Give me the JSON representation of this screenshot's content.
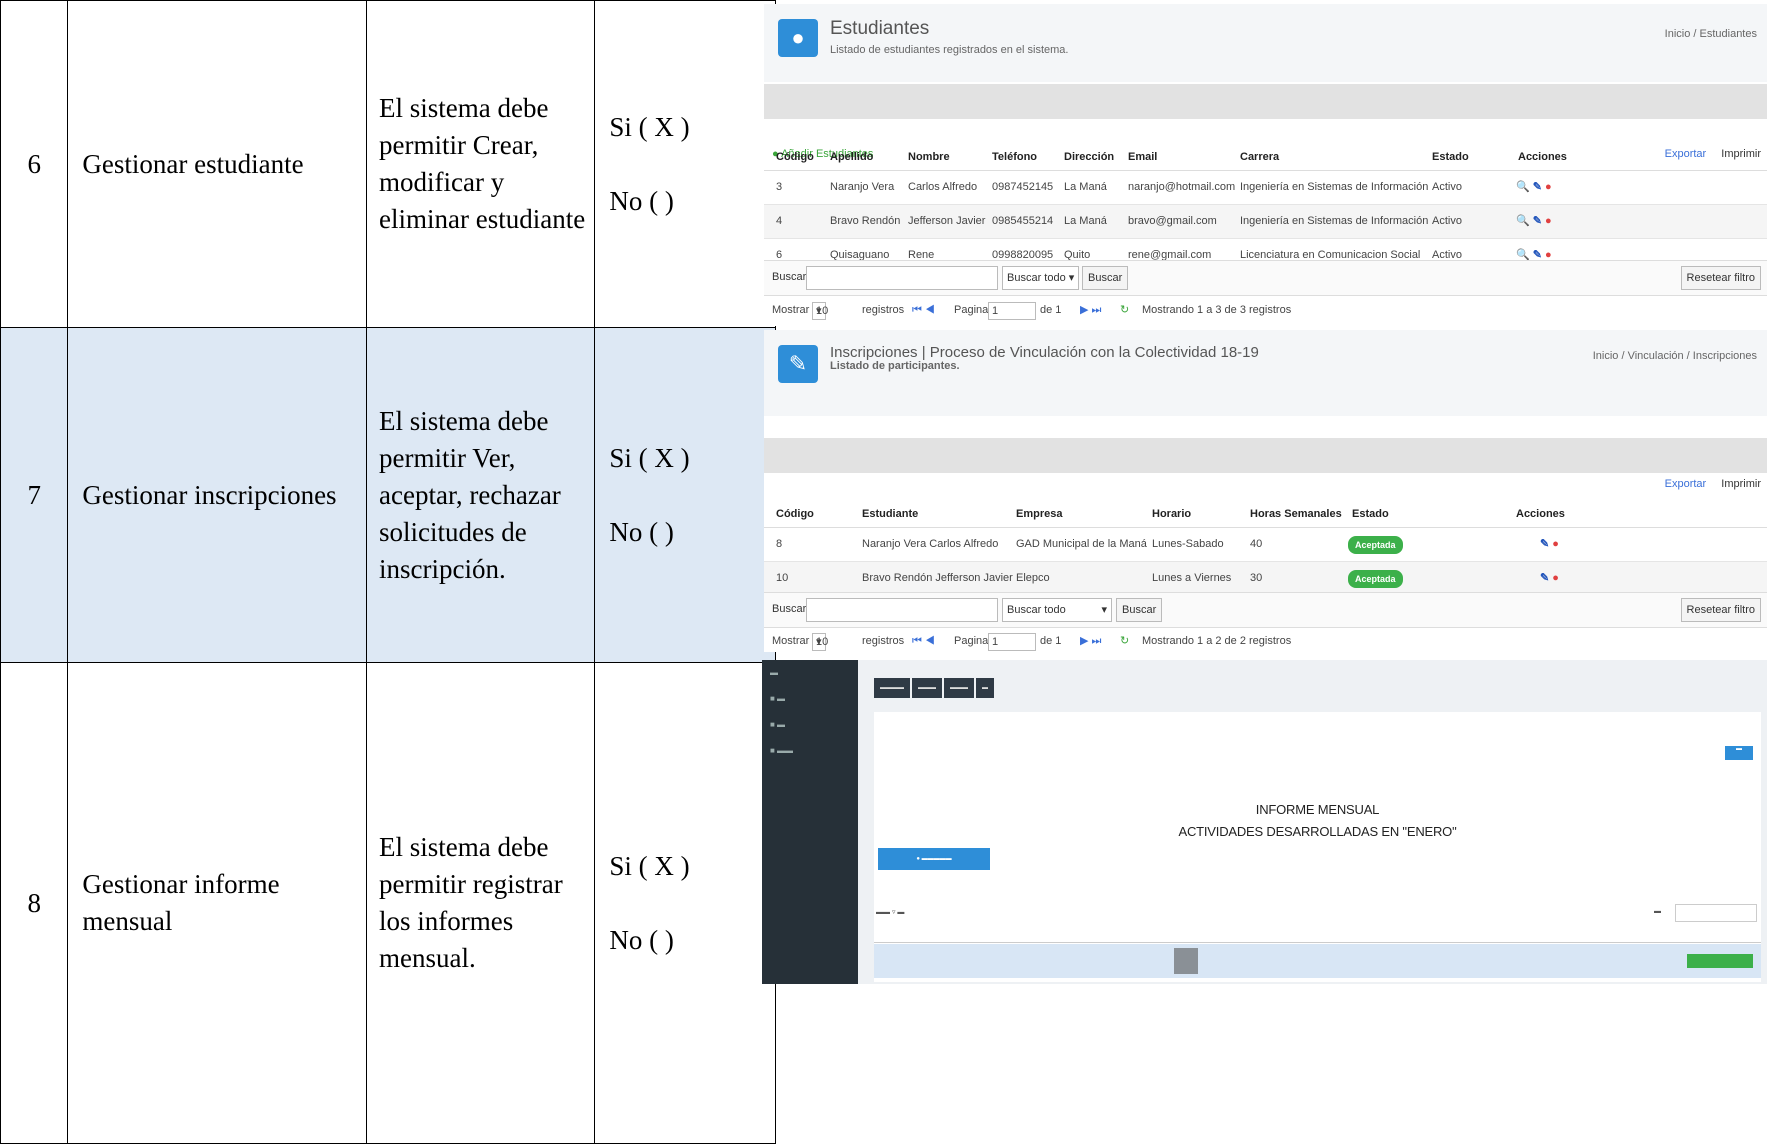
{
  "rows": [
    {
      "num": "6",
      "name": "Gestionar estudiante",
      "desc": "El sistema debe permitir Crear, modificar y eliminar estudiante",
      "si": "Si   ( X )",
      "no": "No (   )"
    },
    {
      "num": "7",
      "name": "Gestionar inscripciones",
      "desc": "El sistema debe permitir Ver, aceptar, rechazar solicitudes de inscripción.",
      "si": "Si   ( X )",
      "no": "No (   )"
    },
    {
      "num": "8",
      "name": "Gestionar informe mensual",
      "desc": "El sistema debe permitir registrar los informes mensual.",
      "si": "Si   ( X )",
      "no": "No (   )"
    }
  ],
  "shot1": {
    "title": "Estudiantes",
    "subtitle": "Listado de estudiantes registrados en el sistema.",
    "breadcrumb": "Inicio  /  Estudiantes",
    "add": "Añadir Estudiantes",
    "export": "Exportar",
    "print": "Imprimir",
    "headers": [
      "Código",
      "Apellido",
      "Nombre",
      "Teléfono",
      "Dirección",
      "Email",
      "Carrera",
      "Estado",
      "Acciones"
    ],
    "data": [
      [
        "3",
        "Naranjo Vera",
        "Carlos Alfredo",
        "0987452145",
        "La Maná",
        "naranjo@hotmail.com",
        "Ingeniería en Sistemas de Información",
        "Activo"
      ],
      [
        "4",
        "Bravo Rendón",
        "Jefferson Javier",
        "0985455214",
        "La Maná",
        "bravo@gmail.com",
        "Ingeniería en Sistemas de Información",
        "Activo"
      ],
      [
        "6",
        "Quisaguano",
        "Rene",
        "0998820095",
        "Quito",
        "rene@gmail.com",
        "Licenciatura en Comunicacion Social",
        "Activo"
      ]
    ],
    "search_label": "Buscar",
    "search_all": "Buscar todo",
    "search_btn": "Buscar",
    "reset_btn": "Resetear filtro",
    "show": "Mostrar",
    "per_page": "10",
    "records": "registros",
    "page": "Pagina",
    "page_num": "1",
    "of": "de 1",
    "showing": "Mostrando 1 a 3 de 3 registros"
  },
  "shot2": {
    "title": "Inscripciones | Proceso de Vinculación con la Colectividad 18-19",
    "subtitle": "Listado de participantes.",
    "breadcrumb": "Inicio  /  Vinculación  /  Inscripciones",
    "export": "Exportar",
    "print": "Imprimir",
    "headers": [
      "Código",
      "Estudiante",
      "Empresa",
      "Horario",
      "Horas Semanales",
      "Estado",
      "Acciones"
    ],
    "data": [
      [
        "8",
        "Naranjo Vera Carlos Alfredo",
        "GAD Municipal de la Maná",
        "Lunes-Sabado",
        "40",
        "Aceptada"
      ],
      [
        "10",
        "Bravo Rendón Jefferson Javier",
        "Elepco",
        "Lunes a Viernes",
        "30",
        "Aceptada"
      ]
    ],
    "search_label": "Buscar",
    "search_all": "Buscar todo",
    "search_btn": "Buscar",
    "reset_btn": "Resetear filtro",
    "show": "Mostrar",
    "per_page": "10",
    "records": "registros",
    "page": "Pagina",
    "page_num": "1",
    "of": "de 1",
    "showing": "Mostrando 1 a 2 de 2 registros"
  },
  "shot3": {
    "title1": "INFORME MENSUAL",
    "title2": "ACTIVIDADES DESARROLLADAS EN \"ENERO\""
  }
}
